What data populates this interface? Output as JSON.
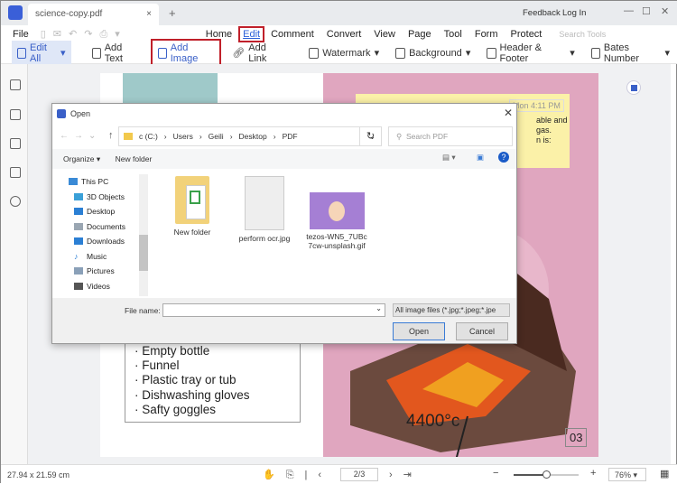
{
  "titlebar": {
    "tab": "science-copy.pdf",
    "close": "×",
    "new_tab": "+",
    "feedback": "Feedback",
    "login": "Log In",
    "window": [
      "—",
      "☐",
      "✕"
    ]
  },
  "menu": {
    "file": "File",
    "items": [
      "Home",
      "Edit",
      "Comment",
      "Convert",
      "View",
      "Page",
      "Tool",
      "Form",
      "Protect"
    ],
    "active": "Edit",
    "search_placeholder": "Search Tools"
  },
  "toolbar": {
    "edit_all": "Edit All",
    "items": [
      "Add Text",
      "Add Image",
      "Add Link",
      "Watermark",
      "Background",
      "Header & Footer",
      "Bates Number"
    ],
    "highlighted": "Add Image",
    "accent": "#c0202a"
  },
  "document": {
    "sticky_time": "Mon 4:11 PM",
    "sticky_text": [
      "able and",
      "gas.",
      "n is:"
    ],
    "list": [
      "· Empty bottle",
      "· Funnel",
      "· Plastic tray or tub",
      "· Dishwashing gloves",
      "· Safty goggles"
    ],
    "temp": "4400°c",
    "page_no": "03"
  },
  "dialog": {
    "title": "Open",
    "breadcrumb": [
      "c (C:)",
      "Users",
      "Geili",
      "Desktop",
      "PDF"
    ],
    "search_placeholder": "Search PDF",
    "organize": "Organize",
    "new_folder": "New folder",
    "nav": [
      {
        "label": "This PC",
        "color": "#3a8ad6"
      },
      {
        "label": "3D Objects",
        "color": "#3aa0d8"
      },
      {
        "label": "Desktop",
        "color": "#2b7fd4"
      },
      {
        "label": "Documents",
        "color": "#9aa6b2"
      },
      {
        "label": "Downloads",
        "color": "#2b7fd4"
      },
      {
        "label": "Music",
        "color": "#2b7fd4"
      },
      {
        "label": "Pictures",
        "color": "#8aa0b8"
      },
      {
        "label": "Videos",
        "color": "#555"
      }
    ],
    "files": [
      "New folder",
      "perform ocr.jpg",
      "tezos-WN5_7UBc7cw-unsplash.gif"
    ],
    "file_name_label": "File name:",
    "file_name_value": "",
    "file_type": "All image files (*.jpg;*.jpeg;*.jpe",
    "open": "Open",
    "cancel": "Cancel"
  },
  "status": {
    "dimensions": "27.94 x 21.59 cm",
    "page": "2/3",
    "zoom": "76%",
    "zoom_level": 0.5
  }
}
